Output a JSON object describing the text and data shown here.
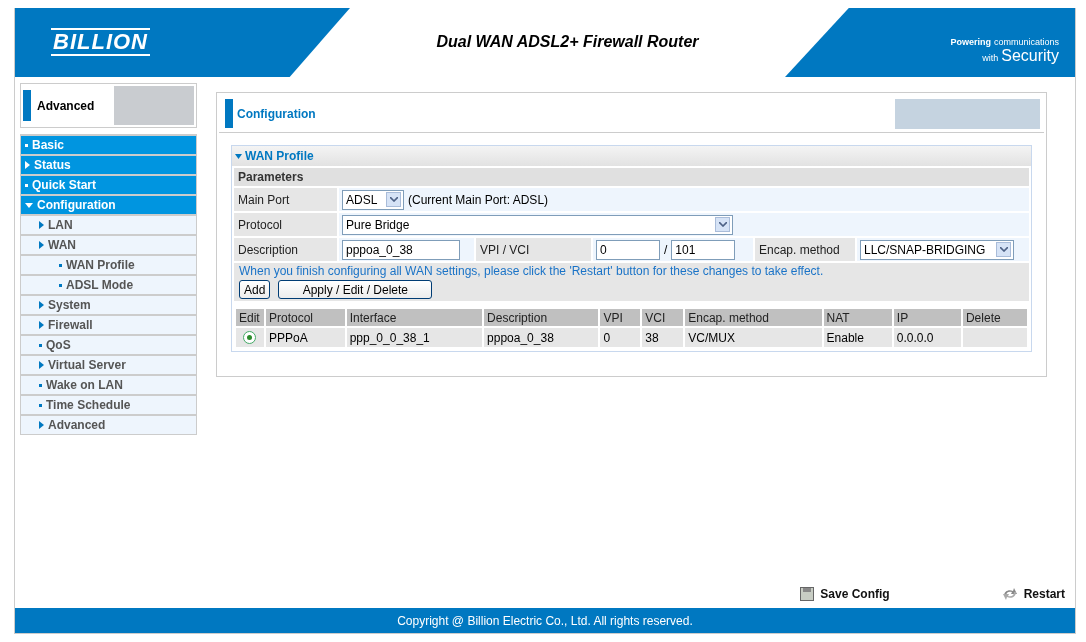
{
  "header": {
    "logo": "BILLION",
    "title": "Dual WAN ADSL2+ Firewall Router",
    "tagline": [
      "Powering",
      "communications",
      "with",
      "Security"
    ]
  },
  "sidebar": {
    "title": "Advanced",
    "items": [
      {
        "label": "Basic",
        "kind": "page"
      },
      {
        "label": "Status",
        "kind": "folder",
        "expanded": false
      },
      {
        "label": "Quick Start",
        "kind": "page"
      },
      {
        "label": "Configuration",
        "kind": "folder",
        "expanded": true,
        "children": [
          {
            "label": "LAN",
            "kind": "folder",
            "expanded": false
          },
          {
            "label": "WAN",
            "kind": "folder",
            "expanded": false,
            "children": [
              {
                "label": "WAN Profile",
                "kind": "page"
              },
              {
                "label": "ADSL Mode",
                "kind": "page"
              }
            ]
          },
          {
            "label": "System",
            "kind": "folder",
            "expanded": false
          },
          {
            "label": "Firewall",
            "kind": "folder",
            "expanded": false
          },
          {
            "label": "QoS",
            "kind": "page"
          },
          {
            "label": "Virtual Server",
            "kind": "folder",
            "expanded": false
          },
          {
            "label": "Wake on LAN",
            "kind": "page"
          },
          {
            "label": "Time Schedule",
            "kind": "page"
          },
          {
            "label": "Advanced",
            "kind": "folder",
            "expanded": false
          }
        ]
      }
    ]
  },
  "page": {
    "title": "Configuration",
    "section": "WAN Profile",
    "subsection": "Parameters",
    "main_port": {
      "label": "Main Port",
      "value": "ADSL",
      "note": "(Current Main Port: ADSL)"
    },
    "protocol": {
      "label": "Protocol",
      "value": "Pure Bridge"
    },
    "description": {
      "label": "Description",
      "value": "pppoa_0_38"
    },
    "vpi_vci": {
      "label": "VPI / VCI",
      "vpi": "0",
      "separator": "/",
      "vci": "101"
    },
    "encap": {
      "label": "Encap. method",
      "value": "LLC/SNAP-BRIDGING"
    },
    "notice": "When you finish configuring all WAN settings, please click the 'Restart' button for these changes to take effect.",
    "buttons": [
      "Add",
      "Apply / Edit / Delete"
    ],
    "table": {
      "columns": [
        "Edit",
        "Protocol",
        "Interface",
        "Description",
        "VPI",
        "VCI",
        "Encap. method",
        "NAT",
        "IP",
        "Delete"
      ],
      "rows": [
        {
          "selected": true,
          "cells": [
            "",
            "PPPoA",
            "ppp_0_0_38_1",
            "pppoa_0_38",
            "0",
            "38",
            "VC/MUX",
            "Enable",
            "0.0.0.0",
            ""
          ]
        }
      ]
    }
  },
  "actions": [
    {
      "kind": "save",
      "label": "Save Config"
    },
    {
      "kind": "restart",
      "label": "Restart"
    }
  ],
  "footer": "Copyright @ Billion Electric Co., Ltd. All rights reserved."
}
